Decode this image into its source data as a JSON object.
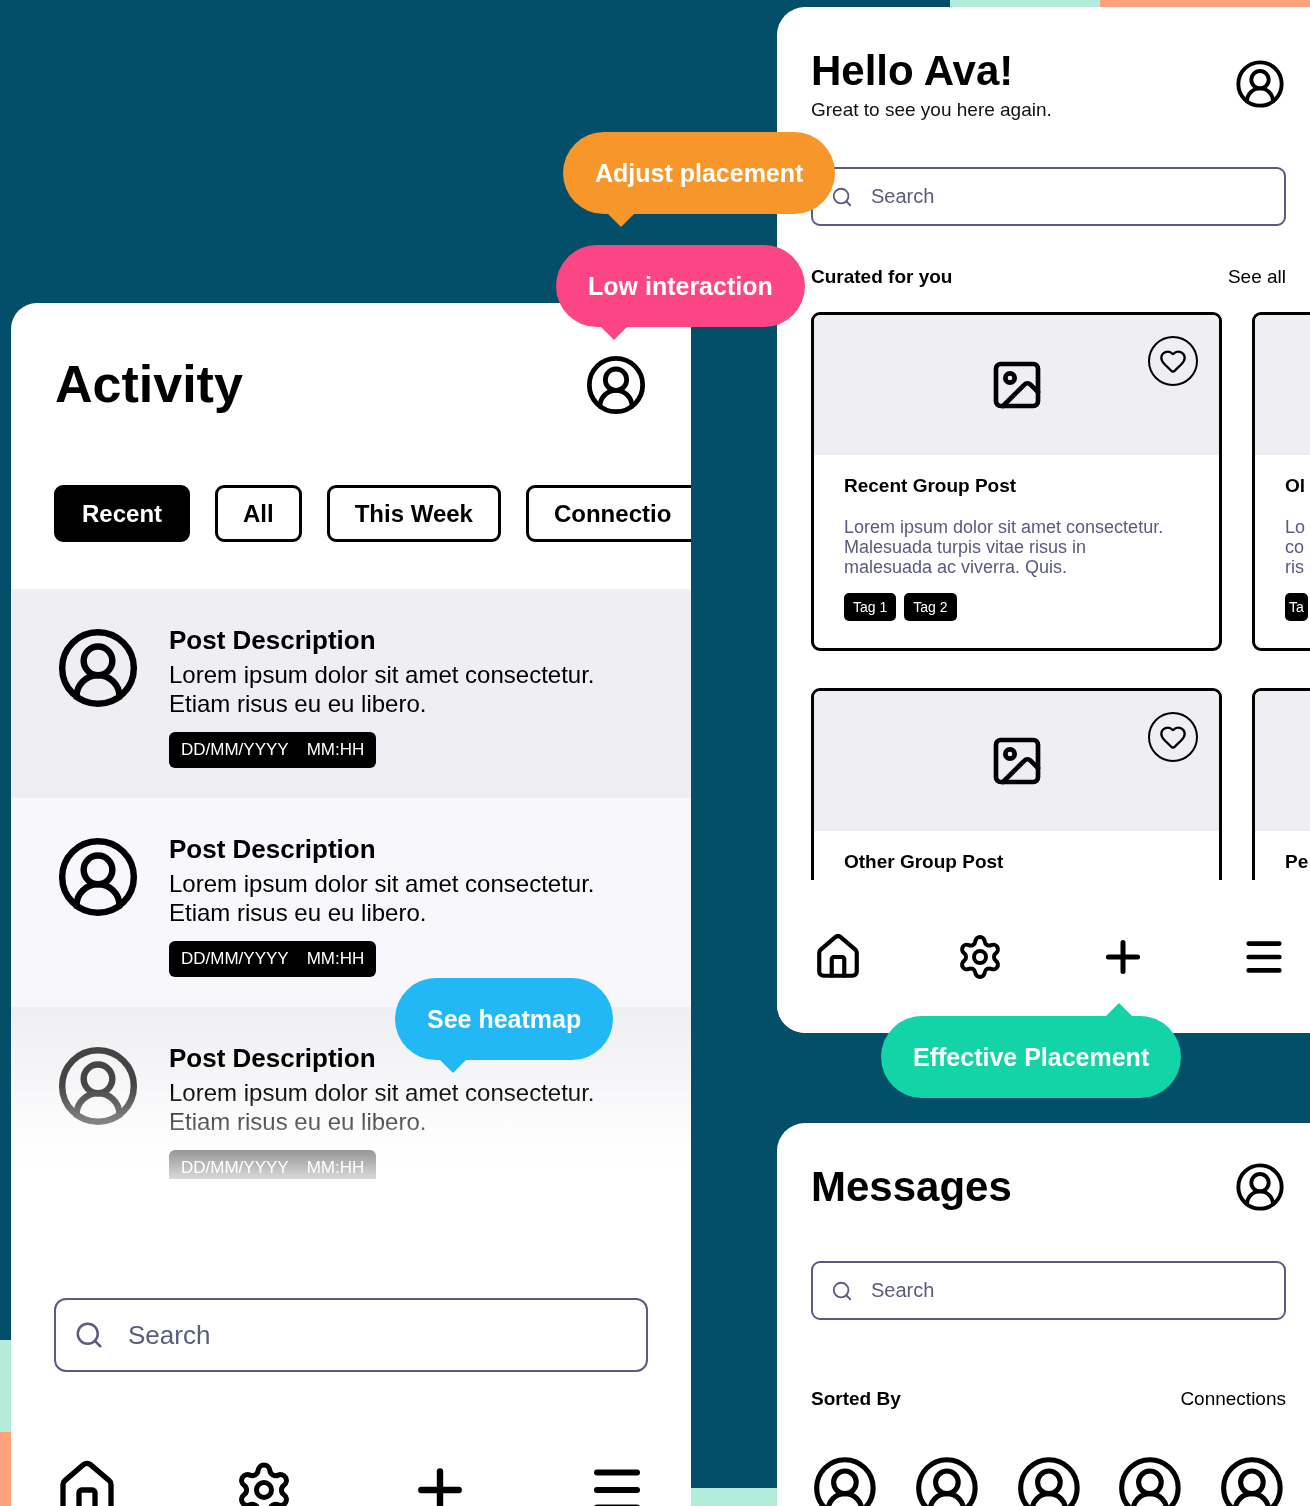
{
  "activity_screen": {
    "title": "Activity",
    "filters": [
      {
        "label": "Recent",
        "selected": true
      },
      {
        "label": "All",
        "selected": false
      },
      {
        "label": "This Week",
        "selected": false
      },
      {
        "label": "Connectio",
        "selected": false
      }
    ],
    "posts": [
      {
        "title": "Post Description",
        "body": "Lorem ipsum dolor sit amet consectetur. Etiam risus eu eu libero.",
        "date": "DD/MM/YYYY",
        "time": "MM:HH",
        "faded": false
      },
      {
        "title": "Post Description",
        "body": "Lorem ipsum dolor sit amet consectetur. Etiam risus eu eu libero.",
        "date": "DD/MM/YYYY",
        "time": "MM:HH",
        "faded": false
      },
      {
        "title": "Post Description",
        "body": "Lorem ipsum dolor sit amet consectetur. Etiam risus eu eu libero.",
        "date": "DD/MM/YYYY",
        "time": "MM:HH",
        "faded": true
      }
    ],
    "search": {
      "placeholder": "Search"
    }
  },
  "home_screen": {
    "greeting": "Hello Ava!",
    "subtitle": "Great to see you here again.",
    "search": {
      "placeholder": "Search"
    },
    "section": {
      "title": "Curated for you",
      "link": "See all"
    },
    "cards": [
      {
        "kind": "full",
        "title": "Recent Group Post",
        "body": "Lorem ipsum dolor sit amet consectetur. Malesuada turpis vitae risus in malesuada ac viverra. Quis.",
        "tags": [
          "Tag 1",
          "Tag 2"
        ]
      },
      {
        "kind": "clipped",
        "title": "Ol",
        "body": "Lo co ris",
        "tags": [
          "Ta"
        ]
      },
      {
        "kind": "full",
        "title": "Other Group Post"
      },
      {
        "kind": "clipped",
        "title": "Pe"
      }
    ]
  },
  "messages_screen": {
    "title": "Messages",
    "search": {
      "placeholder": "Search"
    },
    "sort_label": "Sorted By",
    "sort_value": "Connections"
  },
  "callouts": [
    {
      "text": "Adjust placement",
      "color": "#f7962a"
    },
    {
      "text": "Low interaction",
      "color": "#fc4584"
    },
    {
      "text": "See heatmap",
      "color": "#22b8f5"
    },
    {
      "text": "Effective Placement",
      "color": "#12d4a6"
    }
  ]
}
